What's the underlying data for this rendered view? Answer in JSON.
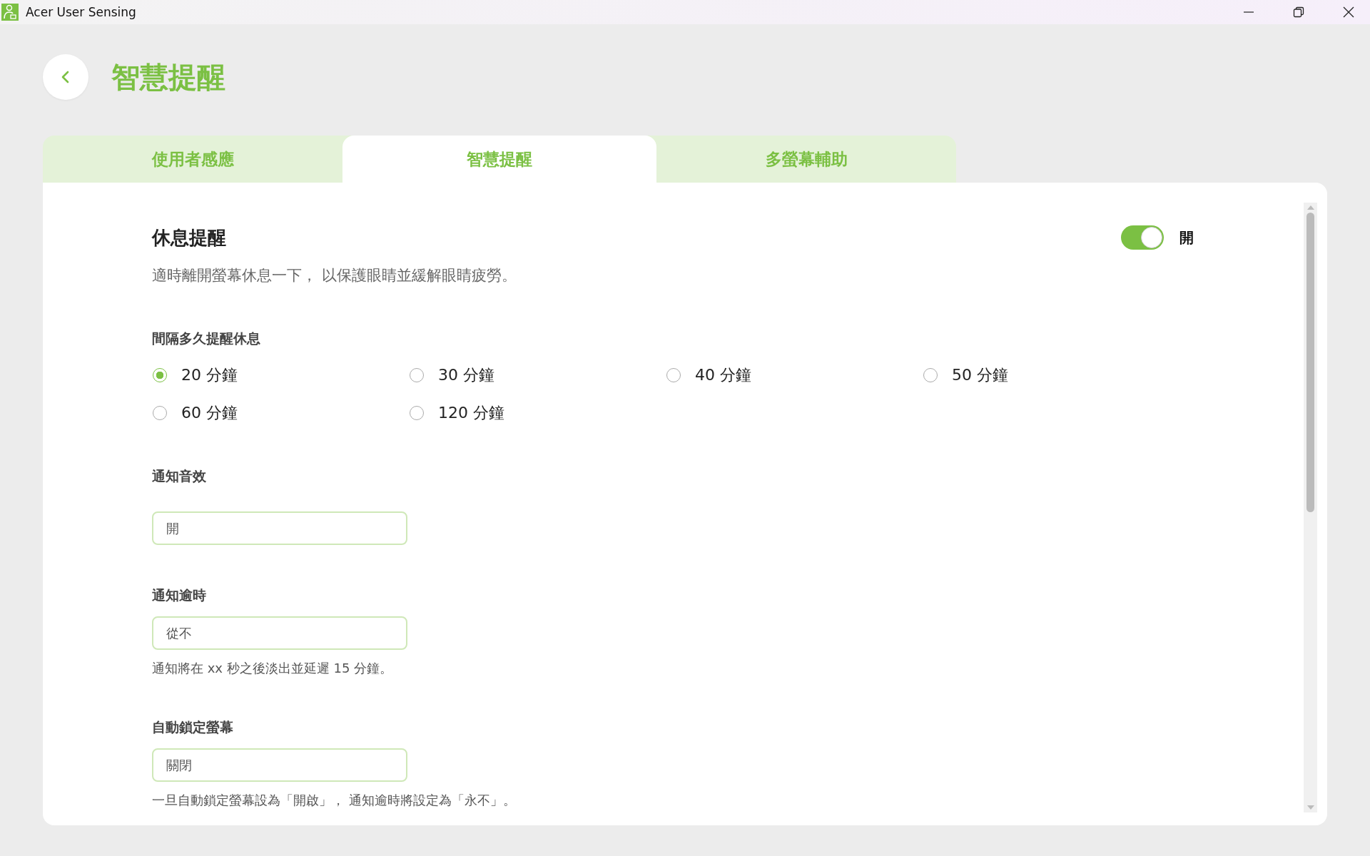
{
  "window": {
    "title": "Acer User Sensing"
  },
  "header": {
    "title": "智慧提醒"
  },
  "tabs": [
    {
      "label": "使用者感應",
      "selected": false
    },
    {
      "label": "智慧提醒",
      "selected": true
    },
    {
      "label": "多螢幕輔助",
      "selected": false
    }
  ],
  "section": {
    "title": "休息提醒",
    "description": "適時離開螢幕休息一下， 以保護眼睛並緩解眼睛疲勞。",
    "toggle": {
      "on": true,
      "label": "開"
    }
  },
  "interval": {
    "label": "間隔多久提醒休息",
    "options": [
      {
        "label": "20 分鐘",
        "selected": true
      },
      {
        "label": "30 分鐘",
        "selected": false
      },
      {
        "label": "40 分鐘",
        "selected": false
      },
      {
        "label": "50 分鐘",
        "selected": false
      },
      {
        "label": "60 分鐘",
        "selected": false
      },
      {
        "label": "120 分鐘",
        "selected": false
      }
    ]
  },
  "fields": [
    {
      "label": "通知音效",
      "value": "開"
    },
    {
      "label": "通知逾時",
      "value": "從不",
      "hint": "通知將在 xx 秒之後淡出並延遲 15 分鐘。"
    },
    {
      "label": "自動鎖定螢幕",
      "value": "關閉",
      "hint": "一旦自動鎖定螢幕設為「開啟」， 通知逾時將設定為「永不」。"
    }
  ]
}
